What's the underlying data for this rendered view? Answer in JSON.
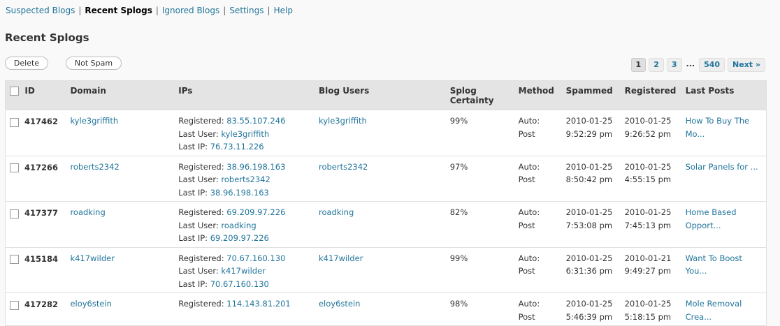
{
  "subnav": {
    "items": [
      {
        "label": "Suspected Blogs",
        "current": false
      },
      {
        "label": "Recent Splogs",
        "current": true
      },
      {
        "label": "Ignored Blogs",
        "current": false
      },
      {
        "label": "Settings",
        "current": false
      },
      {
        "label": "Help",
        "current": false
      }
    ],
    "separator": "|"
  },
  "page_title": "Recent Splogs",
  "actions": {
    "delete_label": "Delete",
    "notspam_label": "Not Spam"
  },
  "pagination": {
    "pages": [
      "1",
      "2",
      "3"
    ],
    "current": "1",
    "ellipsis": "...",
    "last": "540",
    "next": "Next »"
  },
  "table": {
    "headers": {
      "id": "ID",
      "domain": "Domain",
      "ips": "IPs",
      "blog_users": "Blog Users",
      "certainty_l1": "Splog",
      "certainty_l2": "Certainty",
      "method": "Method",
      "spammed": "Spammed",
      "registered": "Registered",
      "last_posts": "Last Posts"
    },
    "labels": {
      "registered": "Registered:",
      "last_user": "Last User:",
      "last_ip": "Last IP:"
    },
    "rows": [
      {
        "id": "417462",
        "domain": "kyle3griffith",
        "reg_ip": "83.55.107.246",
        "last_user": "kyle3griffith",
        "last_ip": "76.73.11.226",
        "blog_user": "kyle3griffith",
        "certainty": "99%",
        "method_l1": "Auto:",
        "method_l2": "Post",
        "spammed_date": "2010-01-25",
        "spammed_time": "9:52:29 pm",
        "registered_date": "2010-01-25",
        "registered_time": "9:26:52 pm",
        "post_l1": "How To Buy The",
        "post_l2": "Mo..."
      },
      {
        "id": "417266",
        "domain": "roberts2342",
        "reg_ip": "38.96.198.163",
        "last_user": "roberts2342",
        "last_ip": "38.96.198.163",
        "blog_user": "roberts2342",
        "certainty": "97%",
        "method_l1": "Auto:",
        "method_l2": "Post",
        "spammed_date": "2010-01-25",
        "spammed_time": "8:50:42 pm",
        "registered_date": "2010-01-25",
        "registered_time": "4:55:15 pm",
        "post_l1": "Solar Panels for ...",
        "post_l2": ""
      },
      {
        "id": "417377",
        "domain": "roadking",
        "reg_ip": "69.209.97.226",
        "last_user": "roadking",
        "last_ip": "69.209.97.226",
        "blog_user": "roadking",
        "certainty": "82%",
        "method_l1": "Auto:",
        "method_l2": "Post",
        "spammed_date": "2010-01-25",
        "spammed_time": "7:53:08 pm",
        "registered_date": "2010-01-25",
        "registered_time": "7:45:13 pm",
        "post_l1": "Home Based",
        "post_l2": "Opport..."
      },
      {
        "id": "415184",
        "domain": "k417wilder",
        "reg_ip": "70.67.160.130",
        "last_user": "k417wilder",
        "last_ip": "70.67.160.130",
        "blog_user": "k417wilder",
        "certainty": "99%",
        "method_l1": "Auto:",
        "method_l2": "Post",
        "spammed_date": "2010-01-25",
        "spammed_time": "6:31:36 pm",
        "registered_date": "2010-01-21",
        "registered_time": "9:49:27 pm",
        "post_l1": "Want To Boost",
        "post_l2": "You..."
      },
      {
        "id": "417282",
        "domain": "eloy6stein",
        "reg_ip": "114.143.81.201",
        "last_user": "",
        "last_ip": "",
        "blog_user": "eloy6stein",
        "certainty": "98%",
        "method_l1": "Auto:",
        "method_l2": "Post",
        "spammed_date": "2010-01-25",
        "spammed_time": "5:46:39 pm",
        "registered_date": "2010-01-25",
        "registered_time": "5:18:15 pm",
        "post_l1": "Mole Removal",
        "post_l2": "Crea..."
      }
    ]
  },
  "colors": {
    "link": "#21759b",
    "header_bg": "#e4e4e4",
    "page_bg": "#f9f9f9"
  }
}
